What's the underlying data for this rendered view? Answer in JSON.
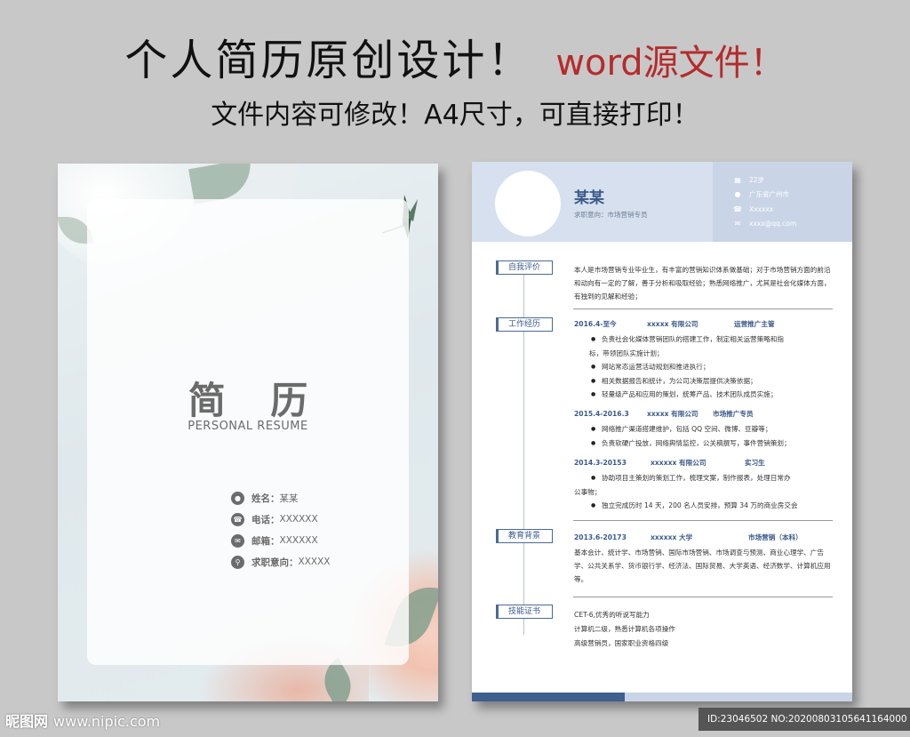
{
  "headline": {
    "main": "个人简历原创设计！",
    "accent": "word源文件！",
    "sub": "文件内容可修改！A4尺寸，可直接打印！"
  },
  "cover": {
    "title_cn": "简 历",
    "title_en": "PERSONAL RESUME",
    "info": [
      {
        "icon": "user-icon",
        "label": "姓名：",
        "value": "某某"
      },
      {
        "icon": "phone-icon",
        "label": "电话：",
        "value": "XXXXXX"
      },
      {
        "icon": "mail-icon",
        "label": "邮箱：",
        "value": "XXXXXX"
      },
      {
        "icon": "search-icon",
        "label": "求职意向：",
        "value": "XXXXX"
      }
    ]
  },
  "resume": {
    "name": "某某",
    "intention": "求职意向：市场营销专员",
    "contacts": [
      {
        "icon": "calendar-icon",
        "text": "22岁"
      },
      {
        "icon": "location-icon",
        "text": "广东省广州市"
      },
      {
        "icon": "phone-icon",
        "text": "Xxxxxx"
      },
      {
        "icon": "mail-icon",
        "text": "xxxx@qq.com"
      }
    ],
    "sections": {
      "self": {
        "label": "自我评价",
        "text": "本人是市场营销专业毕业生，有丰富的营销知识体系做基础；对于市场营销方面的前沿和动向有一定的了解，善于分析和吸取经验；熟悉网络推广，尤其是社会化媒体方面，有独到的见解和经验；"
      },
      "work": {
        "label": "工作经历",
        "jobs": [
          {
            "date": "2016.4-至今",
            "company": "xxxxx 有限公司",
            "role": "运营推广主管",
            "items": [
              "负责社会化媒体营销团队的搭建工作，制定相关运营策略和指",
              "标，带领团队实施计划；",
              "网站常态运营活动规划和推进执行；",
              "相关数据报告和统计，为公司决策层提供决策依据；",
              "轻量级产品和应用的策划，统筹产品、技术团队成员实施；"
            ]
          },
          {
            "date": "2015.4-2016.3",
            "company": "xxxxx 有限公司",
            "role": "市场推广专员",
            "items": [
              "网络推广渠道搭建维护，包括 QQ 空间、微博、豆瓣等；",
              "负责软硬广投放，网络舆情监控，公关稿撰写，事件营销策划；"
            ]
          },
          {
            "date": "2014.3-20153",
            "company": "xxxxxx 有限公司",
            "role": "实习生",
            "items": [
              "协助项目主策划的策划工作，梳理文案，制作报表，处理日常办",
              "公事物；",
              "独立完成历时 14 天，200 名人员安排，预算 34 万的商业房交会"
            ]
          }
        ]
      },
      "edu": {
        "label": "教育背景",
        "date": "2013.6-20173",
        "school": "xxxxxx 大学",
        "major": "市场营销（本科）",
        "text": "基本会计、统计学、市场营销、国际市场营销、市场调查与预测、商业心理学、广告学、公共关系学、货币银行学、经济法、国际贸易、大学英语、经济数学、计算机应用等。"
      },
      "cert": {
        "label": "技能证书",
        "items": [
          "CET-6,优秀的听说写能力",
          "计算机二级，熟悉计算机各项操作",
          "高级营销员，国家职业资格四级"
        ]
      }
    }
  },
  "watermark": {
    "site": "昵图网",
    "url": "www.nipic.com",
    "id": "ID:23046502 NO:20200803105641164000"
  }
}
